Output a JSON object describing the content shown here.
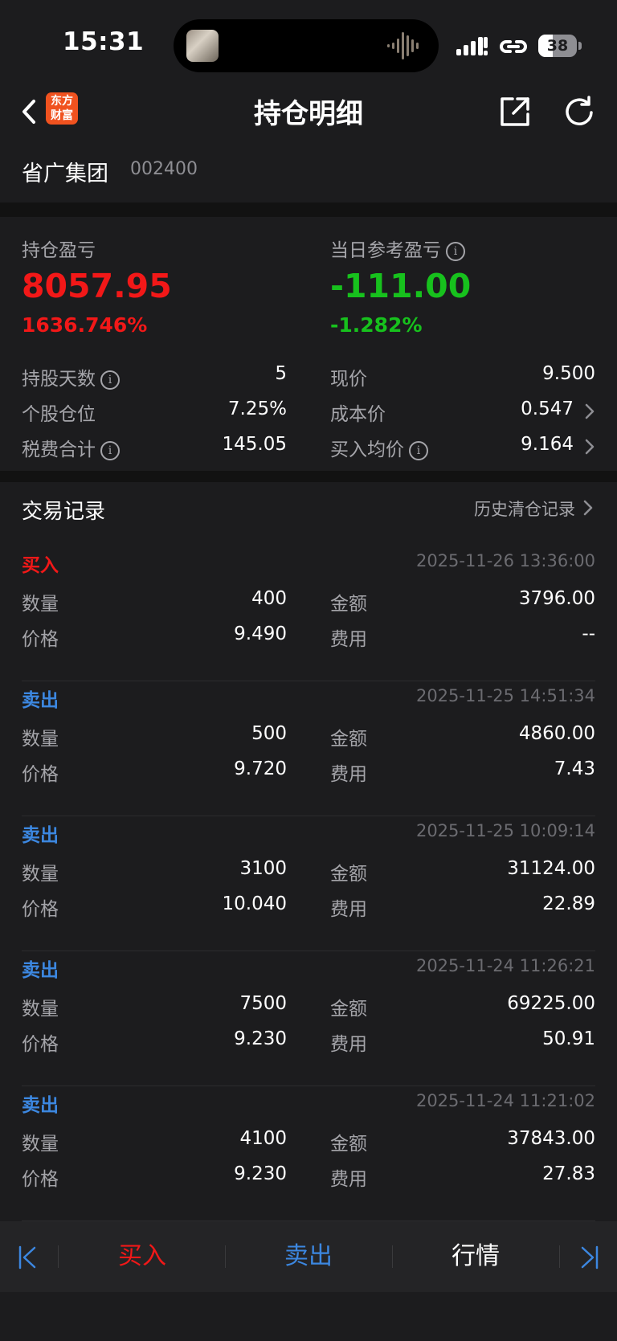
{
  "status_bar": {
    "time": "15:31",
    "battery": "38",
    "battery_level": 0.38
  },
  "nav": {
    "title": "持仓明细",
    "logo_line1": "东方",
    "logo_line2": "财富"
  },
  "stock": {
    "name": "省广集团",
    "code": "002400"
  },
  "summary": {
    "holding_pl_label": "持仓盈亏",
    "holding_pl_value": "8057.95",
    "holding_pl_pct": "1636.746%",
    "daily_pl_label": "当日参考盈亏",
    "daily_pl_value": "-111.00",
    "daily_pl_pct": "-1.282%",
    "info_glyph": "i",
    "left_rows": [
      {
        "label": "持股天数",
        "value": "5"
      },
      {
        "label": "个股仓位",
        "value": "7.25%"
      },
      {
        "label": "税费合计",
        "value": "145.05"
      }
    ],
    "right_rows": [
      {
        "label": "现价",
        "value": "9.500"
      },
      {
        "label": "成本价",
        "value": "0.547"
      },
      {
        "label": "买入均价",
        "value": "9.164"
      }
    ]
  },
  "trades_section": {
    "title": "交易记录",
    "history_link": "历史清仓记录",
    "labels": {
      "qty": "数量",
      "amount": "金额",
      "price": "价格",
      "fee": "费用"
    },
    "records": [
      {
        "type": "买入",
        "side": "buy",
        "time": "2025-11-26 13:36:00",
        "qty": "400",
        "amount": "3796.00",
        "price": "9.490",
        "fee": "--"
      },
      {
        "type": "卖出",
        "side": "sell",
        "time": "2025-11-25 14:51:34",
        "qty": "500",
        "amount": "4860.00",
        "price": "9.720",
        "fee": "7.43"
      },
      {
        "type": "卖出",
        "side": "sell",
        "time": "2025-11-25 10:09:14",
        "qty": "3100",
        "amount": "31124.00",
        "price": "10.040",
        "fee": "22.89"
      },
      {
        "type": "卖出",
        "side": "sell",
        "time": "2025-11-24 11:26:21",
        "qty": "7500",
        "amount": "69225.00",
        "price": "9.230",
        "fee": "50.91"
      },
      {
        "type": "卖出",
        "side": "sell",
        "time": "2025-11-24 11:21:02",
        "qty": "4100",
        "amount": "37843.00",
        "price": "9.230",
        "fee": "27.83"
      }
    ]
  },
  "bottom_bar": {
    "buy": "买入",
    "sell": "卖出",
    "market": "行情"
  },
  "colors": {
    "red": "#f21818",
    "green": "#17c11d",
    "blue": "#3c87e0",
    "background": "#1c1c1e"
  }
}
